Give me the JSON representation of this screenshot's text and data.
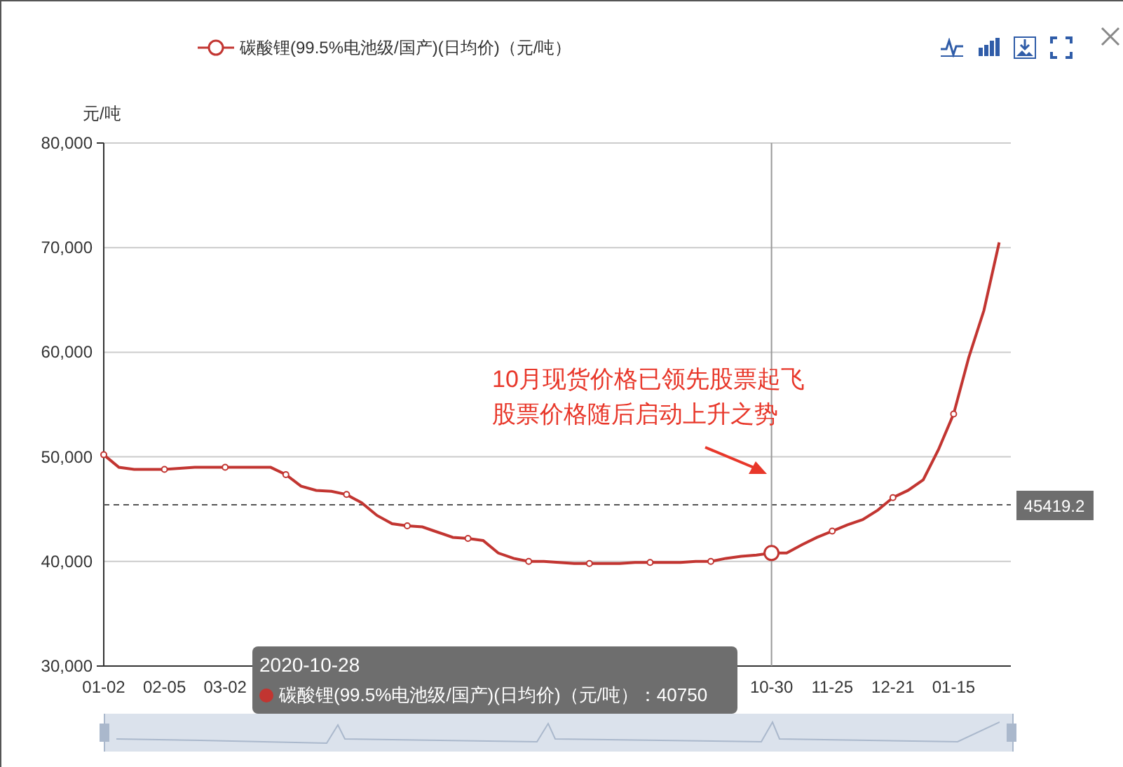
{
  "chart_data": {
    "type": "line",
    "ylabel": "元/吨",
    "categories": [
      "01-02",
      null,
      null,
      null,
      "02-05",
      null,
      null,
      null,
      "03-02",
      null,
      null,
      null,
      null,
      null,
      null,
      null,
      null,
      null,
      null,
      null,
      null,
      null,
      null,
      null,
      null,
      null,
      null,
      null,
      null,
      null,
      null,
      null,
      null,
      null,
      null,
      null,
      null,
      null,
      null,
      null,
      null,
      null,
      null,
      null,
      "10-30",
      null,
      null,
      null,
      "11-25",
      null,
      null,
      null,
      "12-21",
      null,
      null,
      null,
      "01-15",
      null,
      null,
      null
    ],
    "series": [
      {
        "name": "碳酸锂(99.5%电池级/国产)(日均价)（元/吨）",
        "color": "#c23531",
        "values": [
          50200,
          49000,
          48800,
          48800,
          48800,
          48900,
          49000,
          49000,
          49000,
          49000,
          49000,
          49000,
          48300,
          47200,
          46800,
          46700,
          46400,
          45600,
          44400,
          43600,
          43400,
          43300,
          42800,
          42300,
          42200,
          42000,
          40800,
          40300,
          40000,
          40000,
          39900,
          39800,
          39800,
          39800,
          39800,
          39900,
          39900,
          39900,
          39900,
          40000,
          40000,
          40300,
          40500,
          40600,
          40800,
          40800,
          41600,
          42300,
          42900,
          43500,
          44000,
          44900,
          46100,
          46800,
          47800,
          50700,
          54100,
          59500,
          64000,
          70500
        ]
      }
    ],
    "ylim": [
      30000,
      80000
    ],
    "yticks": [
      {
        "value": 30000,
        "label": "30,000"
      },
      {
        "value": 40000,
        "label": "40,000"
      },
      {
        "value": 50000,
        "label": "50,000"
      },
      {
        "value": 60000,
        "label": "60,000"
      },
      {
        "value": 70000,
        "label": "70,000"
      },
      {
        "value": 80000,
        "label": "80,000"
      }
    ],
    "annotations": [
      {
        "text": "10月现货价格已领先股票起飞"
      },
      {
        "text": "股票价格随后启动上升之势"
      }
    ],
    "ref_lines": [
      {
        "axis": "y",
        "value": 45419.2,
        "label": "45419.2"
      },
      {
        "axis": "x",
        "value": "10-30"
      }
    ],
    "grid": true
  },
  "data_zoom": {
    "level": 1
  },
  "tooltip": {
    "title": "2020-10-28",
    "label": "碳酸锂(99.5%电池级/国产)(日均价)（元/吨）",
    "value": "：40750",
    "color": "#c23531"
  }
}
